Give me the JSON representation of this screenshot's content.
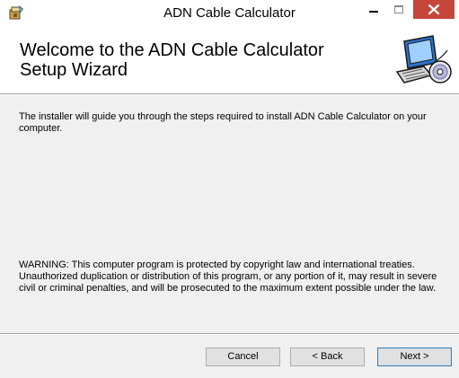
{
  "window": {
    "title": "ADN Cable Calculator",
    "icons": {
      "app": "installer-package-icon",
      "minimize": "minimize-icon",
      "maximize": "maximize-icon",
      "close": "close-icon",
      "banner": "computer-with-disc-icon"
    },
    "colors": {
      "close_button": "#c7463c",
      "dialog_background": "#f0f0f0",
      "banner_background": "#ffffff"
    }
  },
  "banner": {
    "title": "Welcome to the ADN Cable Calculator Setup Wizard"
  },
  "content": {
    "intro": "The installer will guide you through the steps required to install ADN Cable Calculator on your computer.",
    "warning": "WARNING: This computer program is protected by copyright law and international treaties. Unauthorized duplication or distribution of this program, or any portion of it, may result in severe civil or criminal penalties, and will be prosecuted to the maximum extent possible under the law."
  },
  "buttons": {
    "cancel": "Cancel",
    "back": "< Back",
    "next": "Next >"
  }
}
